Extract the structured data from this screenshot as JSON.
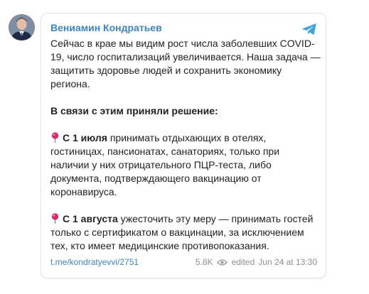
{
  "post": {
    "author": "Вениамин Кондратьев",
    "paragraph1": "Сейчас в крае мы видим рост числа заболевших COVID-19, число госпитализаций увеличивается. Наша задача — защитить здоровье людей и сохранить экономику региона.",
    "paragraph2": "В связи с этим приняли решение:",
    "item1_date": "С 1 июля",
    "item1_text": " принимать отдыхающих в отелях, гостиницах, пансионатах, санаториях, только при наличии у них отрицательного ПЦР-теста, либо документа, подтверждающего вакцинацию от коронавируса.",
    "item2_date": "С 1 августа",
    "item2_text": " ужесточить эту меру — принимать гостей только с сертификатом о вакцинации, за исключением тех, кто имеет медицинские противопоказания.",
    "link": "t.me/kondratyevvi/2751",
    "views": "5.8K",
    "edited_label": "edited",
    "date": "Jun 24 at 13:30"
  },
  "icons": {
    "platform": "telegram-icon",
    "pin": "round-pushpin-icon",
    "views": "eye-icon"
  },
  "colors": {
    "accent": "#3b85c2",
    "telegram": "#3ea4de",
    "pin": "#e0245e"
  }
}
